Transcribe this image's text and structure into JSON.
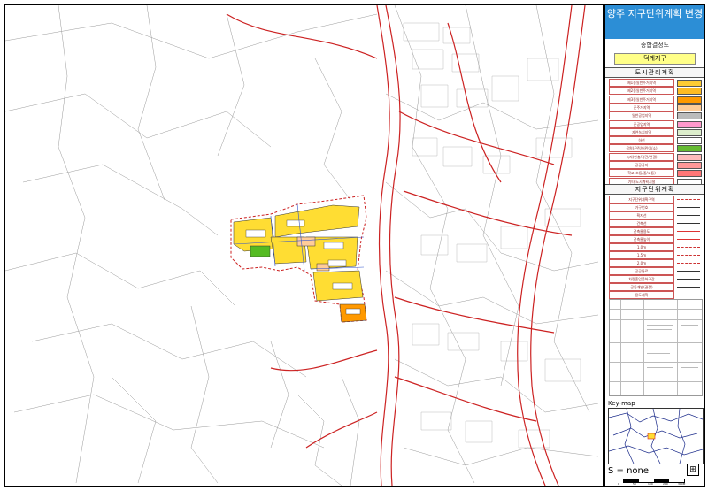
{
  "panel": {
    "title": "양주 지구단위계획 변경",
    "subtitle": "종합결정도",
    "district": "덕계지구",
    "section_urban": "도시관리계획",
    "section_district": "지구단위계획",
    "urban_legend": [
      {
        "label": "제1종일반주거지역",
        "color": "#ffcc33"
      },
      {
        "label": "제2종일반주거지역",
        "color": "#ffbb22"
      },
      {
        "label": "제3종일반주거지역",
        "color": "#ff9900"
      },
      {
        "label": "준주거지역",
        "color": "#ffcc99"
      },
      {
        "label": "일반공업지역",
        "color": "#bbbbbb"
      },
      {
        "label": "준공업지역",
        "color": "#ff99cc"
      },
      {
        "label": "자연녹지지역",
        "color": "#ddeecc"
      },
      {
        "label": "하천",
        "color": "#ffffff"
      },
      {
        "label": "공원(근린/어린이/소)",
        "color": "#66bb33"
      },
      {
        "label": "녹지(완충/경관/연결)",
        "color": "#ffbbbb"
      },
      {
        "label": "공공공지",
        "color": "#ff9999"
      },
      {
        "label": "학교(초등/중/고등)",
        "color": "#ff7777"
      },
      {
        "label": "기타 도시계획시설",
        "color": "#ffffff"
      }
    ],
    "district_legend": [
      {
        "label": "지구단위계획구역",
        "style": "dash"
      },
      {
        "label": "가구번호",
        "style": "line"
      },
      {
        "label": "획지선",
        "style": "line"
      },
      {
        "label": "건축선",
        "style": "line"
      },
      {
        "label": "건축물용도",
        "style": "red"
      },
      {
        "label": "건축물높이",
        "style": "red"
      },
      {
        "label": "1.0m",
        "style": "dash"
      },
      {
        "label": "1.5m",
        "style": "dash"
      },
      {
        "label": "2.0m",
        "style": "dash"
      },
      {
        "label": "공공통로",
        "style": "line"
      },
      {
        "label": "차량출입불허구간",
        "style": "line"
      },
      {
        "label": "공동개발(권장)",
        "style": "line"
      },
      {
        "label": "용도계획",
        "style": "line"
      }
    ],
    "keymap_label": "Key-map",
    "scale_label": "S = none",
    "scale_ticks": [
      "0",
      "50",
      "100",
      "200",
      "300M"
    ]
  },
  "map": {
    "colors": {
      "boundary": "#cc2222",
      "yellow": "#ffdd33",
      "orange": "#ff9900",
      "green": "#55bb22",
      "lines": "#888888"
    }
  }
}
